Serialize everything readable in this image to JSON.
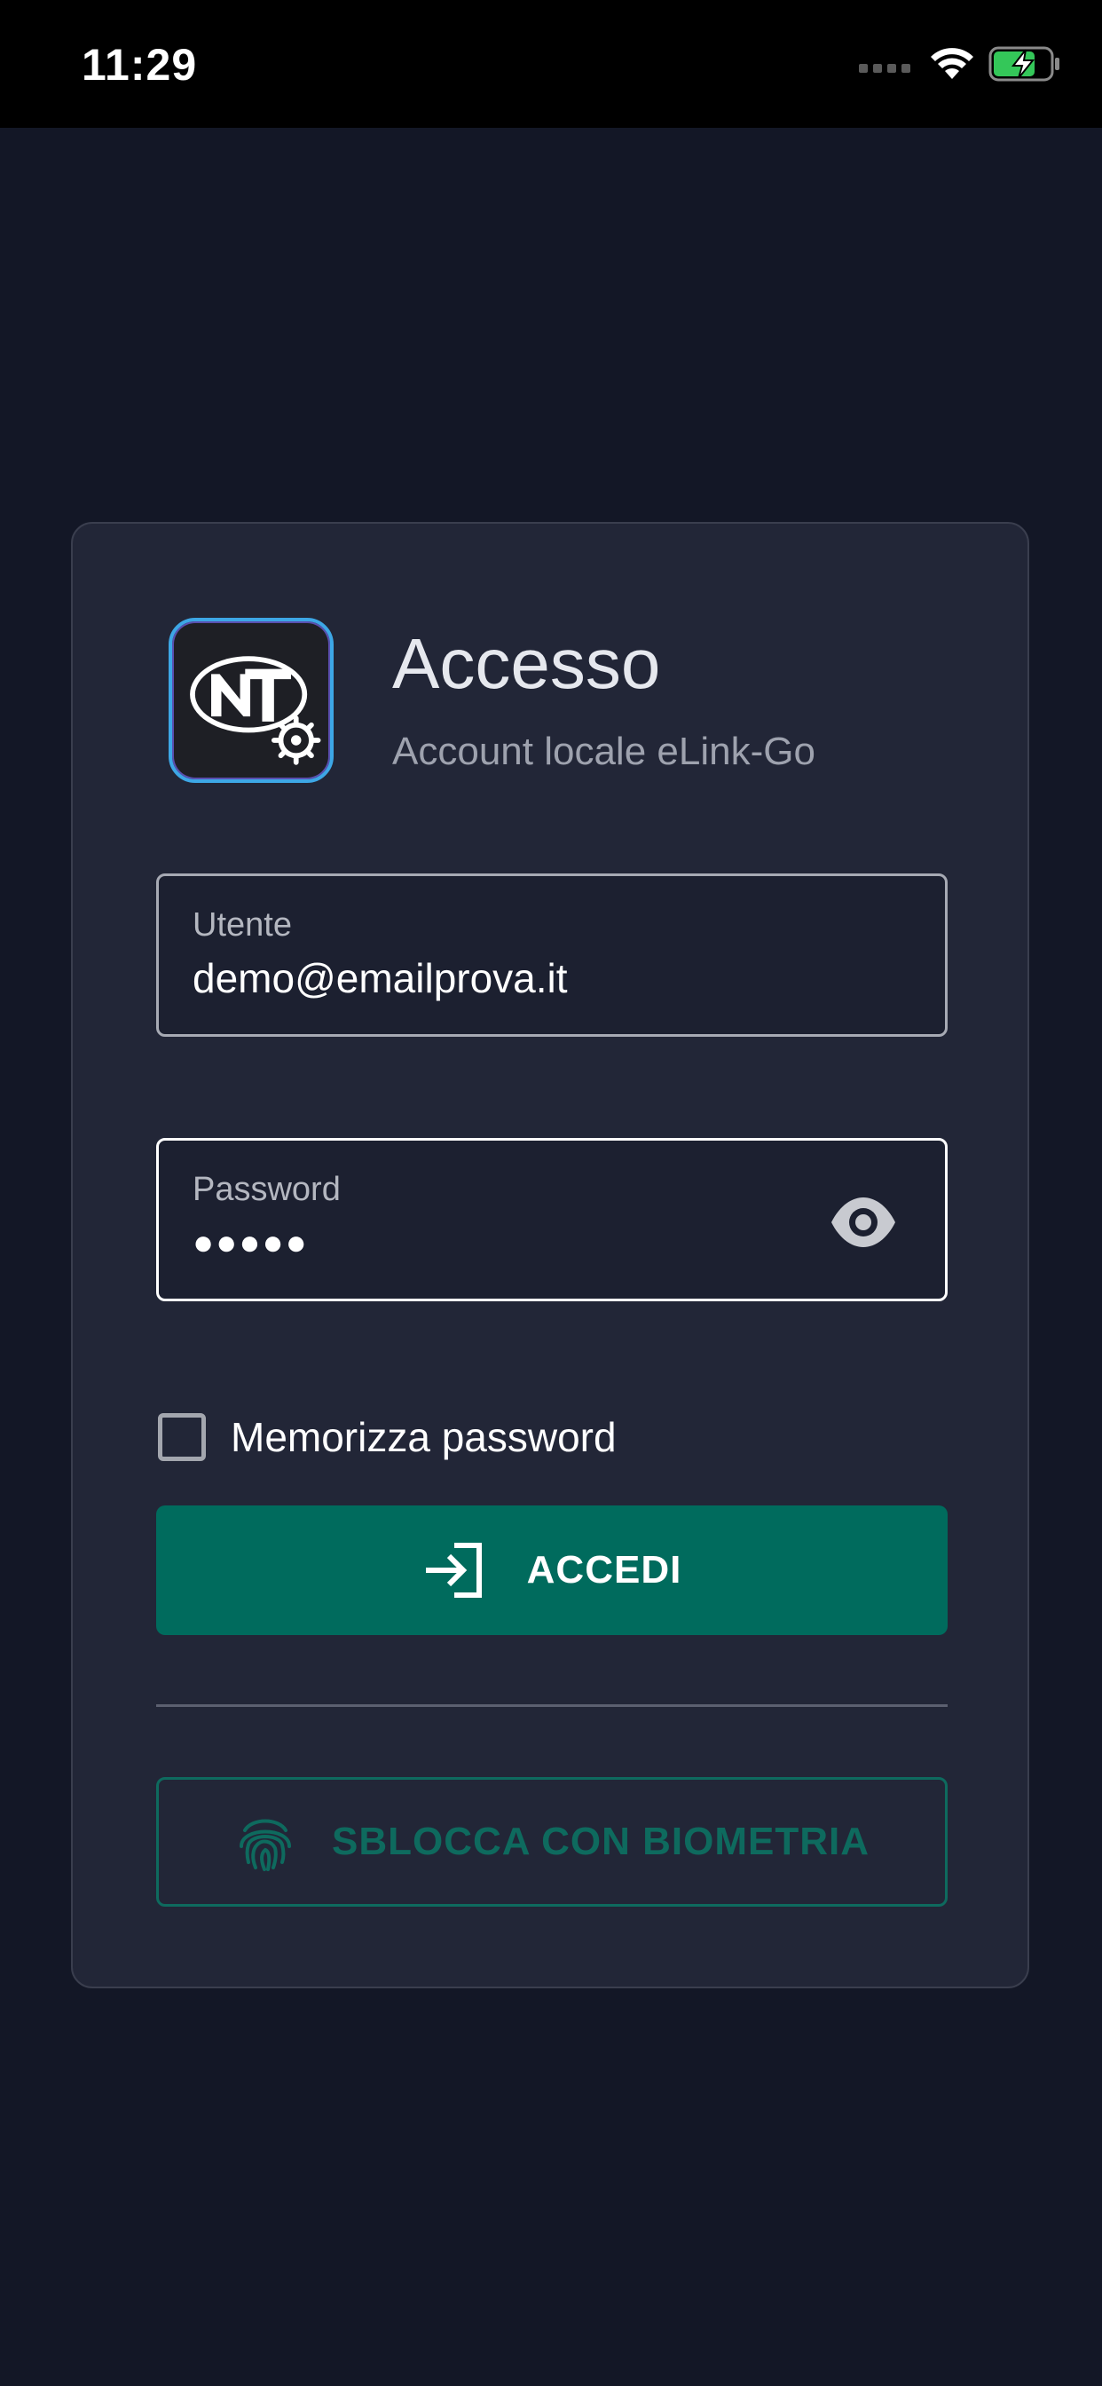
{
  "status_bar": {
    "time": "11:29"
  },
  "login": {
    "title": "Accesso",
    "subtitle": "Account locale eLink-Go",
    "username": {
      "label": "Utente",
      "value": "demo@emailprova.it"
    },
    "password": {
      "label": "Password",
      "masked_value": "●●●●●"
    },
    "remember_label": "Memorizza password",
    "remember_checked": false,
    "login_button_label": "ACCEDI",
    "biometric_button_label": "SBLOCCA CON BIOMETRIA"
  },
  "colors": {
    "background": "#131726",
    "card": "#222637",
    "primary": "#006b5d",
    "biometric": "#0e6a5e"
  },
  "icons": {
    "visibility": "eye-icon",
    "login": "login-arrow-icon",
    "biometric": "fingerprint-icon",
    "wifi": "wifi-icon",
    "battery": "battery-charging-icon"
  }
}
